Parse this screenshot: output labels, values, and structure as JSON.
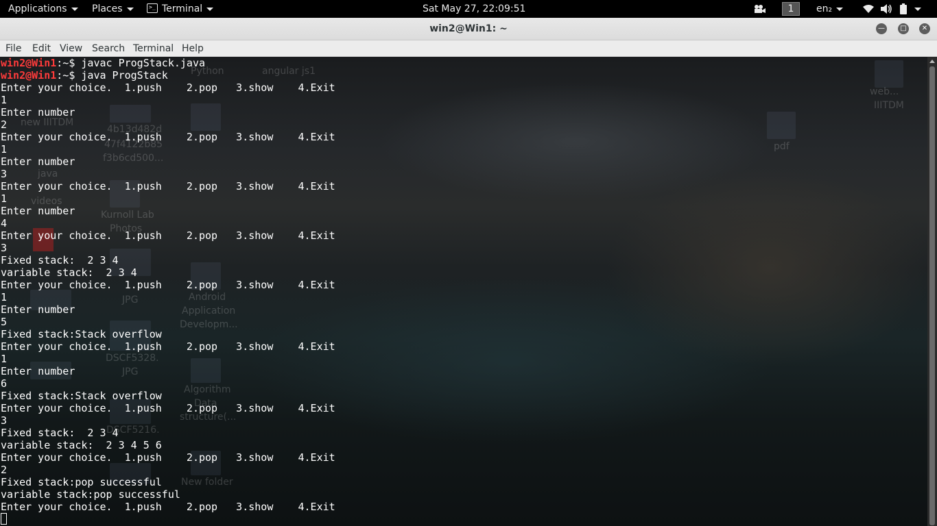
{
  "top_panel": {
    "applications_label": "Applications",
    "places_label": "Places",
    "terminal_label": "Terminal",
    "clock": "Sat May 27, 22:09:51",
    "workspace": "1",
    "language": "en₂"
  },
  "window": {
    "title": "win2@Win1: ~"
  },
  "menu": {
    "file": "File",
    "edit": "Edit",
    "view": "View",
    "search": "Search",
    "terminal": "Terminal",
    "help": "Help"
  },
  "desktop_icons": {
    "python": "Python",
    "angular": "angular js1",
    "web1": "web...",
    "web2": "IIITDM",
    "new_iiitdm": "new IIITDM",
    "hash1": "4b13d482d",
    "hash2": "47f4122b85",
    "hash3": "f3b6cd500...",
    "pdf": "pdf",
    "java": "java",
    "videos": "videos",
    "kurnool1": "Kurnoll Lab",
    "kurnool2": "Photos",
    "jpg1": "JPG",
    "android1": "Android",
    "android2": "Application",
    "android3": "Developm...",
    "dscf1": "DSCF5328.",
    "jpg2": "JPG",
    "algo1": "Algorithm",
    "algo2": "Data",
    "algo3": "structure(...",
    "dscf2": "DSCF5216.",
    "new_folder": "New folder"
  },
  "terminal": {
    "prompt_user": "win2@Win1",
    "prompt_suffix": ":~$",
    "lines": [
      {
        "type": "prompt",
        "cmd": " javac ProgStack.java"
      },
      {
        "type": "prompt",
        "cmd": " java ProgStack"
      },
      {
        "type": "out",
        "text": "Enter your choice.  1.push    2.pop   3.show    4.Exit"
      },
      {
        "type": "out",
        "text": "1"
      },
      {
        "type": "out",
        "text": "Enter number"
      },
      {
        "type": "out",
        "text": "2"
      },
      {
        "type": "out",
        "text": "Enter your choice.  1.push    2.pop   3.show    4.Exit"
      },
      {
        "type": "out",
        "text": "1"
      },
      {
        "type": "out",
        "text": "Enter number"
      },
      {
        "type": "out",
        "text": "3"
      },
      {
        "type": "out",
        "text": "Enter your choice.  1.push    2.pop   3.show    4.Exit"
      },
      {
        "type": "out",
        "text": "1"
      },
      {
        "type": "out",
        "text": "Enter number"
      },
      {
        "type": "out",
        "text": "4"
      },
      {
        "type": "out",
        "text": "Enter your choice.  1.push    2.pop   3.show    4.Exit"
      },
      {
        "type": "out",
        "text": "3"
      },
      {
        "type": "out",
        "text": "Fixed stack:  2 3 4"
      },
      {
        "type": "out",
        "text": "variable stack:  2 3 4"
      },
      {
        "type": "out",
        "text": "Enter your choice.  1.push    2.pop   3.show    4.Exit"
      },
      {
        "type": "out",
        "text": "1"
      },
      {
        "type": "out",
        "text": "Enter number"
      },
      {
        "type": "out",
        "text": "5"
      },
      {
        "type": "out",
        "text": "Fixed stack:Stack overflow"
      },
      {
        "type": "out",
        "text": "Enter your choice.  1.push    2.pop   3.show    4.Exit"
      },
      {
        "type": "out",
        "text": "1"
      },
      {
        "type": "out",
        "text": "Enter number"
      },
      {
        "type": "out",
        "text": "6"
      },
      {
        "type": "out",
        "text": "Fixed stack:Stack overflow"
      },
      {
        "type": "out",
        "text": "Enter your choice.  1.push    2.pop   3.show    4.Exit"
      },
      {
        "type": "out",
        "text": "3"
      },
      {
        "type": "out",
        "text": "Fixed stack:  2 3 4"
      },
      {
        "type": "out",
        "text": "variable stack:  2 3 4 5 6"
      },
      {
        "type": "out",
        "text": "Enter your choice.  1.push    2.pop   3.show    4.Exit"
      },
      {
        "type": "out",
        "text": "2"
      },
      {
        "type": "out",
        "text": "Fixed stack:pop successful"
      },
      {
        "type": "out",
        "text": "variable stack:pop successful"
      },
      {
        "type": "out",
        "text": "Enter your choice.  1.push    2.pop   3.show    4.Exit"
      },
      {
        "type": "cursor"
      }
    ]
  }
}
